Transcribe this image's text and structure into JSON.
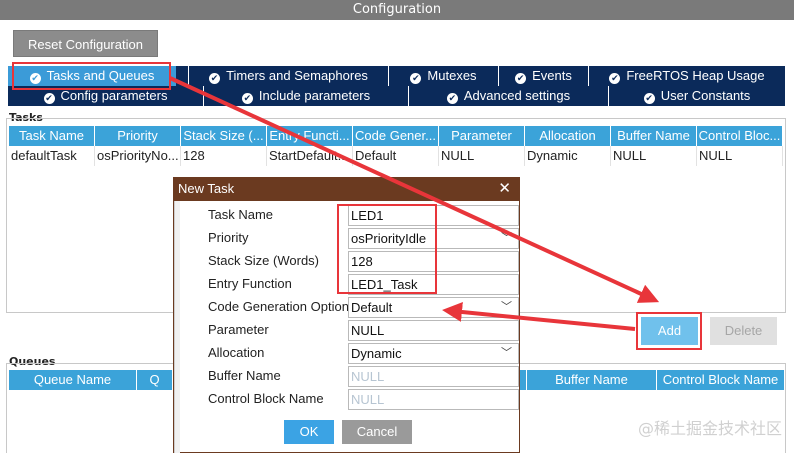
{
  "window": {
    "title": "Configuration"
  },
  "toolbar": {
    "reset_label": "Reset Configuration"
  },
  "tabs_row1": [
    {
      "label": "Tasks and Queues"
    },
    {
      "label": "Timers and Semaphores"
    },
    {
      "label": "Mutexes"
    },
    {
      "label": "Events"
    },
    {
      "label": "FreeRTOS Heap Usage"
    }
  ],
  "tabs_row2": [
    {
      "label": "Config parameters"
    },
    {
      "label": "Include parameters"
    },
    {
      "label": "Advanced settings"
    },
    {
      "label": "User Constants"
    }
  ],
  "check_glyph": "✔",
  "tasks": {
    "group_label": "Tasks",
    "columns": [
      "Task Name",
      "Priority",
      "Stack Size (...",
      "Entry Functi...",
      "Code Gener...",
      "Parameter",
      "Allocation",
      "Buffer Name",
      "Control Bloc..."
    ],
    "rows": [
      [
        "defaultTask",
        "osPriorityNo...",
        "128",
        "StartDefault...",
        "Default",
        "NULL",
        "Dynamic",
        "NULL",
        "NULL"
      ]
    ],
    "add_label": "Add",
    "delete_label": "Delete"
  },
  "queues": {
    "group_label": "Queues",
    "columns": [
      "Queue Name",
      "Q",
      "",
      "",
      "",
      "",
      "",
      "Buffer Name",
      "Control Block Name"
    ]
  },
  "dialog": {
    "title": "New Task",
    "close_glyph": "✕",
    "fields": [
      {
        "label": "Task Name",
        "value": "LED1",
        "type": "text"
      },
      {
        "label": "Priority",
        "value": "osPriorityIdle",
        "type": "select"
      },
      {
        "label": "Stack Size (Words)",
        "value": "128",
        "type": "text"
      },
      {
        "label": "Entry Function",
        "value": "LED1_Task",
        "type": "text"
      },
      {
        "label": "Code Generation Option",
        "value": "Default",
        "type": "select"
      },
      {
        "label": "Parameter",
        "value": "NULL",
        "type": "text"
      },
      {
        "label": "Allocation",
        "value": "Dynamic",
        "type": "select"
      },
      {
        "label": "Buffer Name",
        "value": "NULL",
        "type": "placeholder"
      },
      {
        "label": "Control Block Name",
        "value": "NULL",
        "type": "placeholder"
      }
    ],
    "ok_label": "OK",
    "cancel_label": "Cancel"
  },
  "watermark": "@稀土掘金技术社区",
  "colors": {
    "annotation_red": "#e8353a",
    "tab_bar": "#0b2a5a",
    "tab_active": "#3b9bd8",
    "table_header": "#3ba3d9",
    "dialog_title": "#6b3a20"
  }
}
